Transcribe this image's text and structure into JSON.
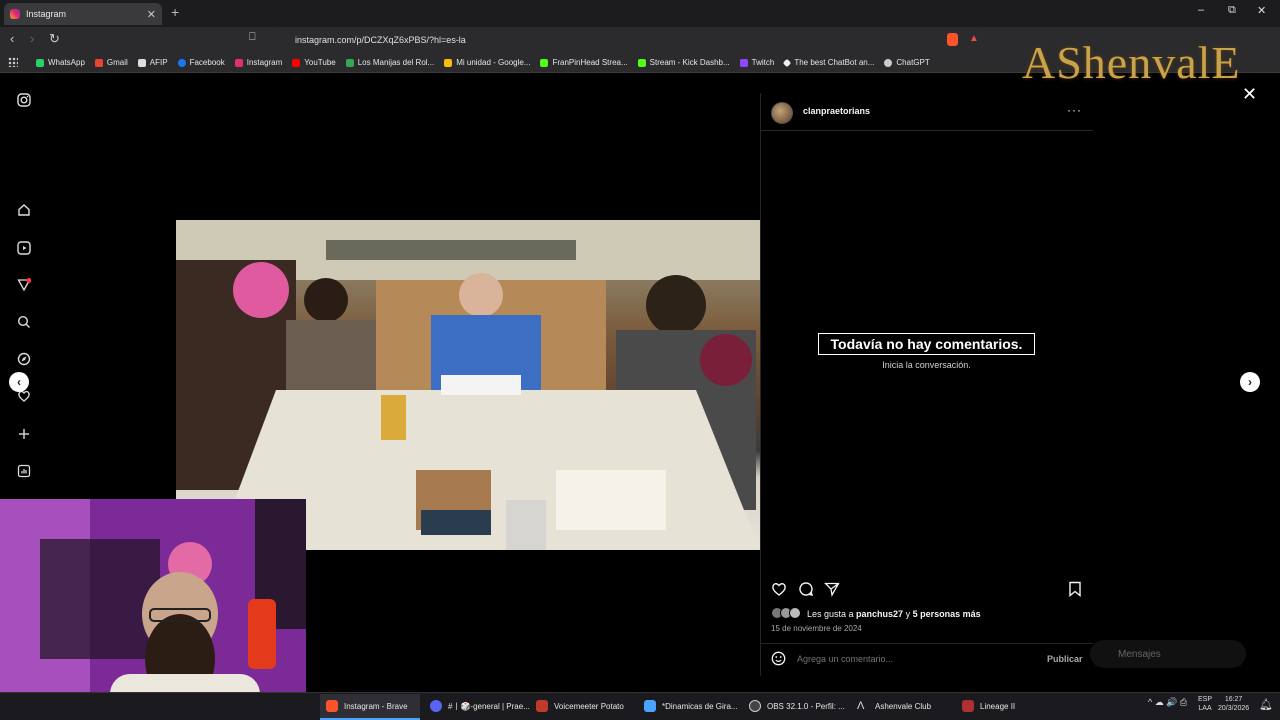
{
  "browser": {
    "tab_title": "Instagram",
    "new_tab": "+",
    "url": "instagram.com/p/DCZXqZ6xPBS/?hl=es-la",
    "bookmarks": [
      {
        "label": "WhatsApp",
        "color": "#25d366"
      },
      {
        "label": "Gmail",
        "color": "#ea4335"
      },
      {
        "label": "AFIP",
        "color": "#dddddd"
      },
      {
        "label": "Facebook",
        "color": "#1877f2"
      },
      {
        "label": "Instagram",
        "color": "#e1306c"
      },
      {
        "label": "YouTube",
        "color": "#ff0000"
      },
      {
        "label": "Los Manijas del Rol...",
        "color": "#34a853"
      },
      {
        "label": "Mi unidad - Google...",
        "color": "#fbbc04"
      },
      {
        "label": "FranPinHead Strea...",
        "color": "#53fc18"
      },
      {
        "label": "Stream - Kick Dashb...",
        "color": "#53fc18"
      },
      {
        "label": "Twitch",
        "color": "#9146ff"
      },
      {
        "label": "The best ChatBot an...",
        "color": "#eeeeee"
      },
      {
        "label": "ChatGPT",
        "color": "#cccccc"
      }
    ],
    "window_controls": [
      "–",
      "⧉",
      "✕"
    ]
  },
  "overlay_logo": "AShenvalE",
  "sidebar_icons": [
    "instagram-icon",
    "home-icon",
    "reels-icon",
    "direct-icon",
    "search-icon",
    "explore-icon",
    "notifications-icon",
    "create-icon",
    "dashboard-icon"
  ],
  "post": {
    "username": "clanpraetorians",
    "more_label": "···",
    "empty_comments_title": "Todavía no hay comentarios.",
    "empty_comments_sub": "Inicia la conversación.",
    "likes_prefix": "Les gusta a ",
    "likes_user": "panchus27",
    "likes_mid": " y ",
    "likes_others": "5 personas más",
    "date": "15 de noviembre de 2024",
    "comment_placeholder": "Agrega un comentario...",
    "publish_label": "Publicar"
  },
  "messages_label": "Mensajes",
  "taskbar": {
    "items": [
      {
        "label": "Instagram - Brave",
        "color": "#fb542b"
      },
      {
        "label": "#⁠丨🎲-general | Prae...",
        "color": "#5865f2"
      },
      {
        "label": "Voicemeeter Potato",
        "color": "#c0392b"
      },
      {
        "label": "*Dinamicas de Gira...",
        "color": "#4aa3ff"
      },
      {
        "label": "OBS 32.1.0 - Perfil: ...",
        "color": "#444444"
      },
      {
        "label": "Ashenvale Club",
        "color": "#dddddd"
      },
      {
        "label": "Lineage II",
        "color": "#b03030"
      }
    ],
    "lang_1": "ESP",
    "lang_2": "LAA",
    "time": "16:27",
    "date": "20/3/2026"
  }
}
